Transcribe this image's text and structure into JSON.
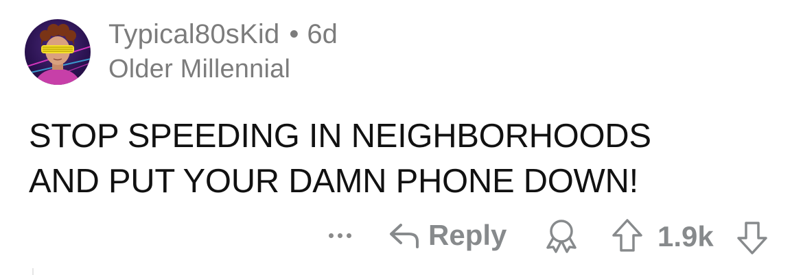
{
  "comment": {
    "author": {
      "username": "Typical80sKid",
      "separator": "•",
      "age": "6d",
      "flair": "Older Millennial",
      "avatar_icon": "retro-80s-avatar-icon"
    },
    "body_lines": [
      "STOP SPEEDING IN NEIGHBORHOODS",
      "AND PUT YOUR DAMN PHONE DOWN!"
    ],
    "actions": {
      "more_icon": "ellipsis-icon",
      "reply_icon": "reply-arrow-icon",
      "reply_label": "Reply",
      "award_icon": "award-icon",
      "upvote_icon": "upvote-arrow-icon",
      "score": "1.9k",
      "downvote_icon": "downvote-arrow-icon"
    }
  },
  "colors": {
    "meta_text": "#7c7c7c",
    "action_text": "#878a8c",
    "body_text": "#111111",
    "background": "#ffffff"
  }
}
